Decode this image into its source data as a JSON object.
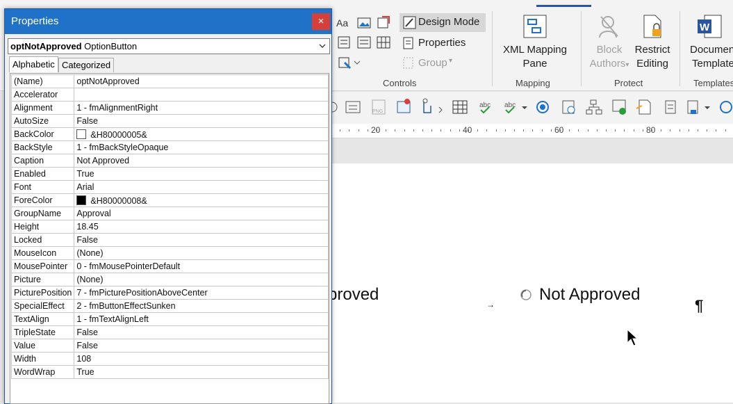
{
  "ribbon": {
    "design_mode": "Design Mode",
    "properties": "Properties",
    "group": "Group",
    "xml_mapping_line1": "XML Mapping",
    "xml_mapping_line2": "Pane",
    "block_authors_line1": "Block",
    "block_authors_line2": "Authors",
    "restrict_editing_line1": "Restrict",
    "restrict_editing_line2": "Editing",
    "document_template_line1": "Documen",
    "document_template_line2": "Template",
    "groups": {
      "controls": "Controls",
      "mapping": "Mapping",
      "protect": "Protect",
      "templates": "Templates"
    }
  },
  "ruler": {
    "marks": [
      "20",
      "40",
      "60",
      "80"
    ]
  },
  "document": {
    "left_label": "proved",
    "right_label": "Not Approved",
    "pilcrow": "¶",
    "tab_mark": "→"
  },
  "props": {
    "title": "Properties",
    "close": "×",
    "object_name": "optNotApproved",
    "object_type": "OptionButton",
    "tabs": {
      "alphabetic": "Alphabetic",
      "categorized": "Categorized"
    },
    "rows": [
      {
        "k": "(Name)",
        "v": "optNotApproved"
      },
      {
        "k": "Accelerator",
        "v": ""
      },
      {
        "k": "Alignment",
        "v": "1 - fmAlignmentRight"
      },
      {
        "k": "AutoSize",
        "v": "False"
      },
      {
        "k": "BackColor",
        "v": "&H80000005&",
        "swatch": "#ffffff"
      },
      {
        "k": "BackStyle",
        "v": "1 - fmBackStyleOpaque"
      },
      {
        "k": "Caption",
        "v": "Not Approved"
      },
      {
        "k": "Enabled",
        "v": "True"
      },
      {
        "k": "Font",
        "v": "Arial"
      },
      {
        "k": "ForeColor",
        "v": "&H80000008&",
        "swatch": "#000000"
      },
      {
        "k": "GroupName",
        "v": "Approval"
      },
      {
        "k": "Height",
        "v": "18.45"
      },
      {
        "k": "Locked",
        "v": "False"
      },
      {
        "k": "MouseIcon",
        "v": "(None)"
      },
      {
        "k": "MousePointer",
        "v": "0 - fmMousePointerDefault"
      },
      {
        "k": "Picture",
        "v": "(None)"
      },
      {
        "k": "PicturePosition",
        "v": "7 - fmPicturePositionAboveCenter"
      },
      {
        "k": "SpecialEffect",
        "v": "2 - fmButtonEffectSunken"
      },
      {
        "k": "TextAlign",
        "v": "1 - fmTextAlignLeft"
      },
      {
        "k": "TripleState",
        "v": "False"
      },
      {
        "k": "Value",
        "v": "False"
      },
      {
        "k": "Width",
        "v": "108"
      },
      {
        "k": "WordWrap",
        "v": "True"
      }
    ]
  },
  "colors": {
    "accent": "#2b579a",
    "title_bar": "#1f72c8",
    "close": "#d6403a"
  }
}
